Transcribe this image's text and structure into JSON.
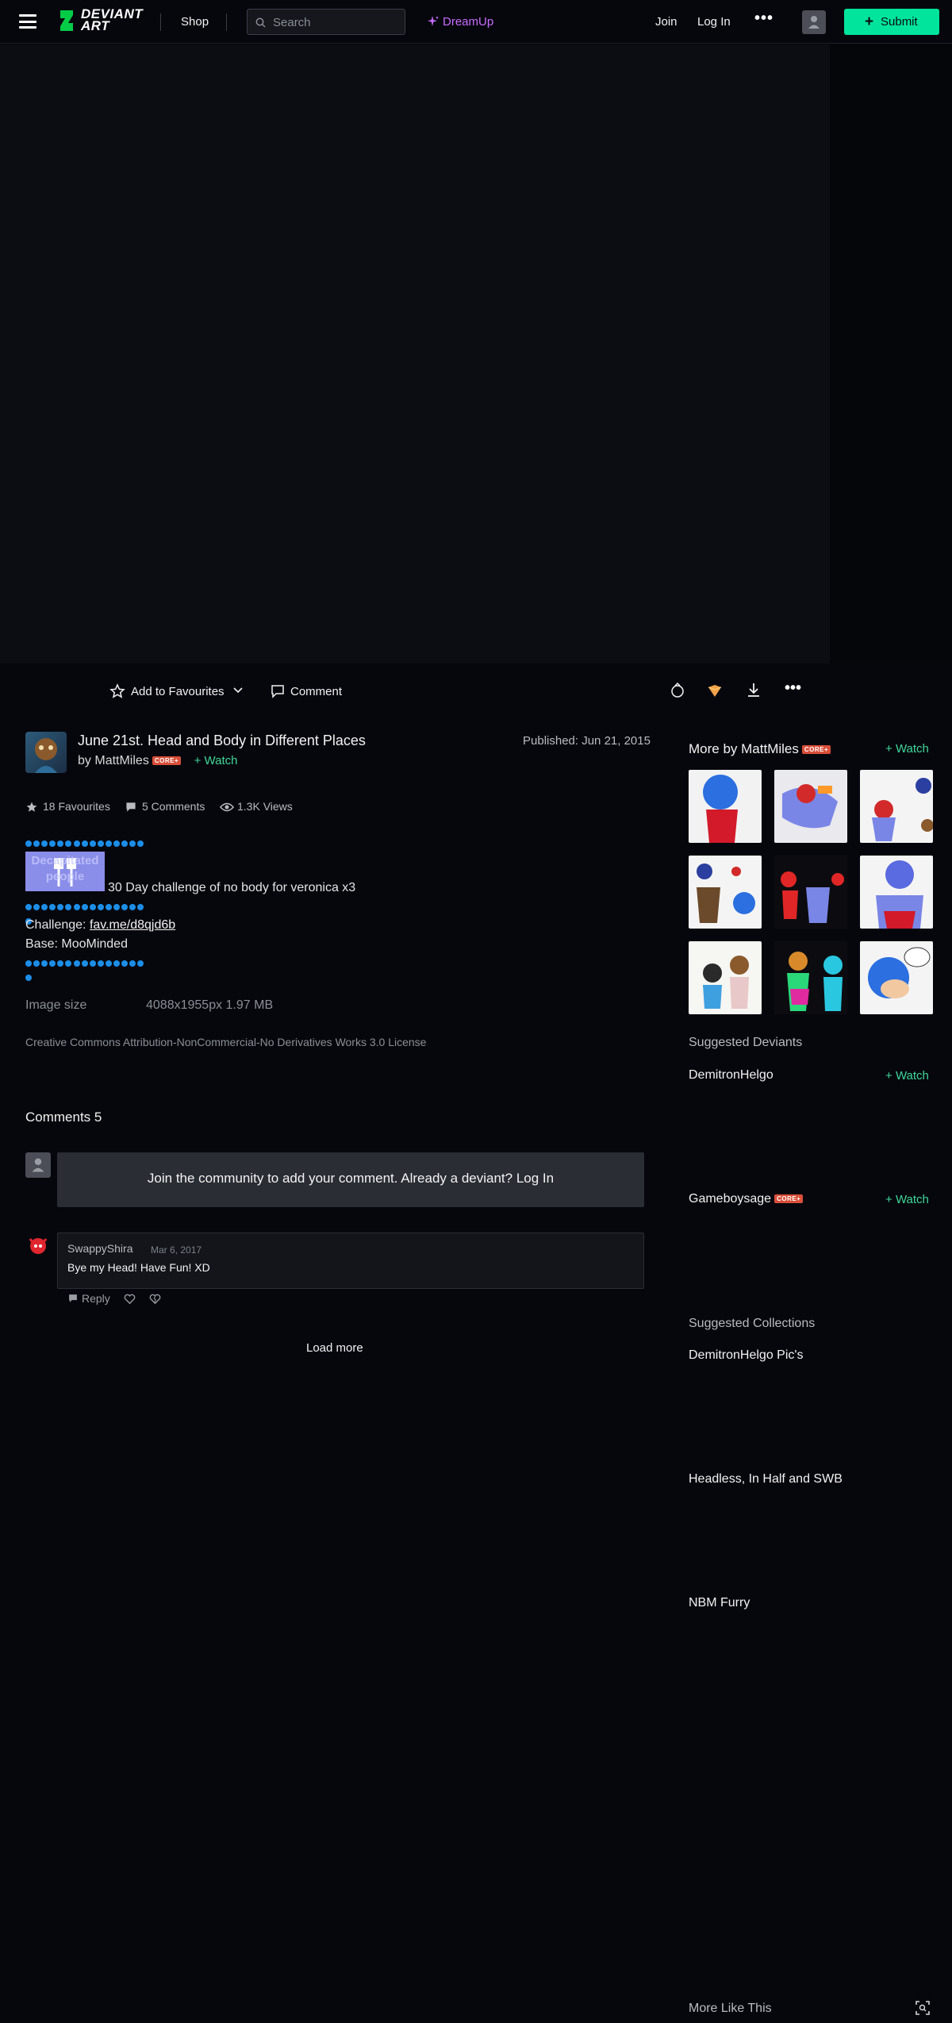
{
  "topbar": {
    "logo_text": "DEVIANT\nART",
    "shop": "Shop",
    "search_placeholder": "Search",
    "dreamup": "DreamUp",
    "join": "Join",
    "login": "Log In",
    "more": "•••",
    "submit": "Submit"
  },
  "actions": {
    "add_fav": "Add to Favourites",
    "comment": "Comment"
  },
  "deviation": {
    "title": "June 21st. Head and Body in Different Places",
    "by": "by",
    "author": "MattMiles",
    "core_badge": "CORE+",
    "watch": "Watch",
    "published": "Published: Jun 21, 2015",
    "favourites": "18 Favourites",
    "comments": "5 Comments",
    "views": "1.3K Views"
  },
  "description": {
    "stamp_text": "Decapitated people",
    "line1": "30 Day challenge of no body for veronica x3",
    "challenge_label": "Challenge:",
    "challenge_link": "fav.me/d8qjd6b",
    "base": "Base: MooMinded"
  },
  "meta": {
    "image_size_label": "Image size",
    "image_size_value": "4088x1955px 1.97 MB",
    "license": "Creative Commons Attribution-NonCommercial-No Derivatives Works 3.0 License"
  },
  "comments": {
    "heading": "Comments 5",
    "join_prompt": "Join the community to add your comment. Already a deviant? Log In",
    "items": [
      {
        "user": "SwappyShira",
        "date": "Mar 6, 2017",
        "text": "Bye my Head! Have Fun! XD",
        "reply": "Reply"
      }
    ],
    "load_more": "Load more"
  },
  "sidebar": {
    "more_by": "More by MattMiles",
    "core_badge": "CORE+",
    "watch": "Watch",
    "suggested_deviants": "Suggested Deviants",
    "deviants": [
      {
        "name": "DemitronHelgo",
        "core": "",
        "watch": "Watch"
      },
      {
        "name": "Gameboysage",
        "core": "CORE+",
        "watch": "Watch"
      }
    ],
    "suggested_collections": "Suggested Collections",
    "collections": [
      "DemitronHelgo Pic's",
      "Headless, In Half and SWB",
      "NBM Furry"
    ],
    "more_like_this": "More Like This"
  },
  "colors": {
    "background": "#06070d",
    "accent_green": "#00e59b",
    "watch_green": "#3fd89a",
    "dreamup_purple": "#c86cff",
    "core_red": "#d94f3a"
  }
}
